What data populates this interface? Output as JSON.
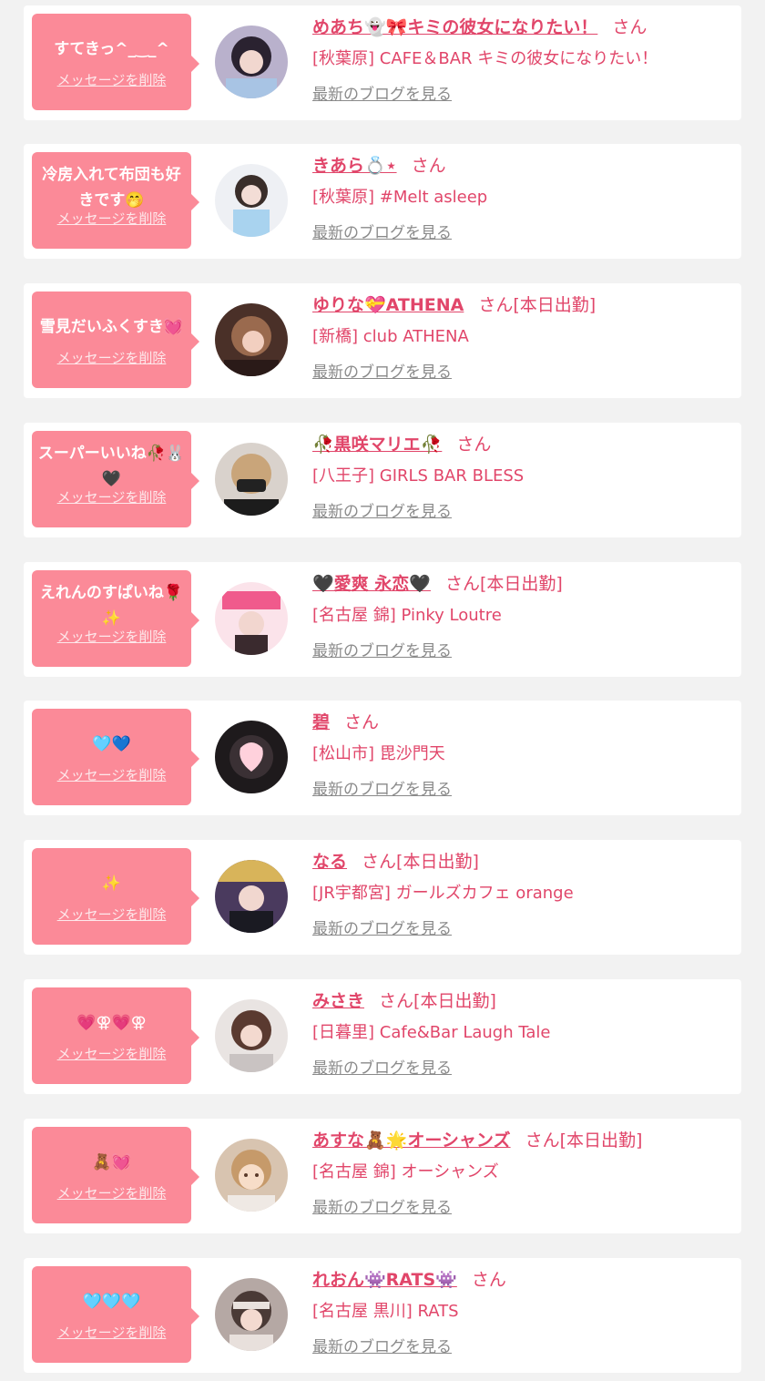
{
  "delete_label": "メッセージを削除",
  "blog_label": "最新のブログを見る",
  "colors": {
    "accent": "#e1466a",
    "bubble": "#fb8a98",
    "background": "#f2f2f2"
  },
  "items": [
    {
      "message": "すてきっ^_‿_^",
      "name": "めあち👻🎀キミの彼女になりたい！",
      "san": "さん",
      "status": "",
      "shop": "[秋葉原] CAFE＆BAR キミの彼女になりたい！"
    },
    {
      "message": "冷房入れて布団も好きです🤭",
      "name": "きあら💍⋆",
      "san": "さん",
      "status": "",
      "shop": "[秋葉原] #Melt asleep"
    },
    {
      "message": "雪見だいふくすき💓",
      "name": "ゆりな💝ATHENA",
      "san": "さん",
      "status": "[本日出勤]",
      "shop": "[新橋] club ATHENA"
    },
    {
      "message": "スーパーいいね🥀🐰🖤",
      "name": "🥀黒咲マリエ🥀",
      "san": "さん",
      "status": "",
      "shop": "[八王子] GIRLS BAR BLESS"
    },
    {
      "message": "えれんのすぱいね🌹✨",
      "name": "🖤愛爽 永恋🖤",
      "san": "さん",
      "status": "[本日出勤]",
      "shop": "[名古屋 錦] Pinky Loutre"
    },
    {
      "message": "🩵💙",
      "name": "碧",
      "san": "さん",
      "status": "",
      "shop": "[松山市] 毘沙門天"
    },
    {
      "message": "✨",
      "name": "なる",
      "san": "さん",
      "status": "[本日出勤]",
      "shop": "[JR宇都宮] ガールズカフェ orange"
    },
    {
      "message": "💗⚢💗⚢",
      "name": "みさき",
      "san": "さん",
      "status": "[本日出勤]",
      "shop": "[日暮里] Cafe&Bar Laugh Tale"
    },
    {
      "message": "🧸💓",
      "name": "あすな🧸🌟オーシャンズ",
      "san": "さん",
      "status": "[本日出勤]",
      "shop": "[名古屋 錦] オーシャンズ"
    },
    {
      "message": "🩵🩵🩵",
      "name": "れおん👾RATS👾",
      "san": "さん",
      "status": "",
      "shop": "[名古屋 黒川] RATS"
    }
  ]
}
